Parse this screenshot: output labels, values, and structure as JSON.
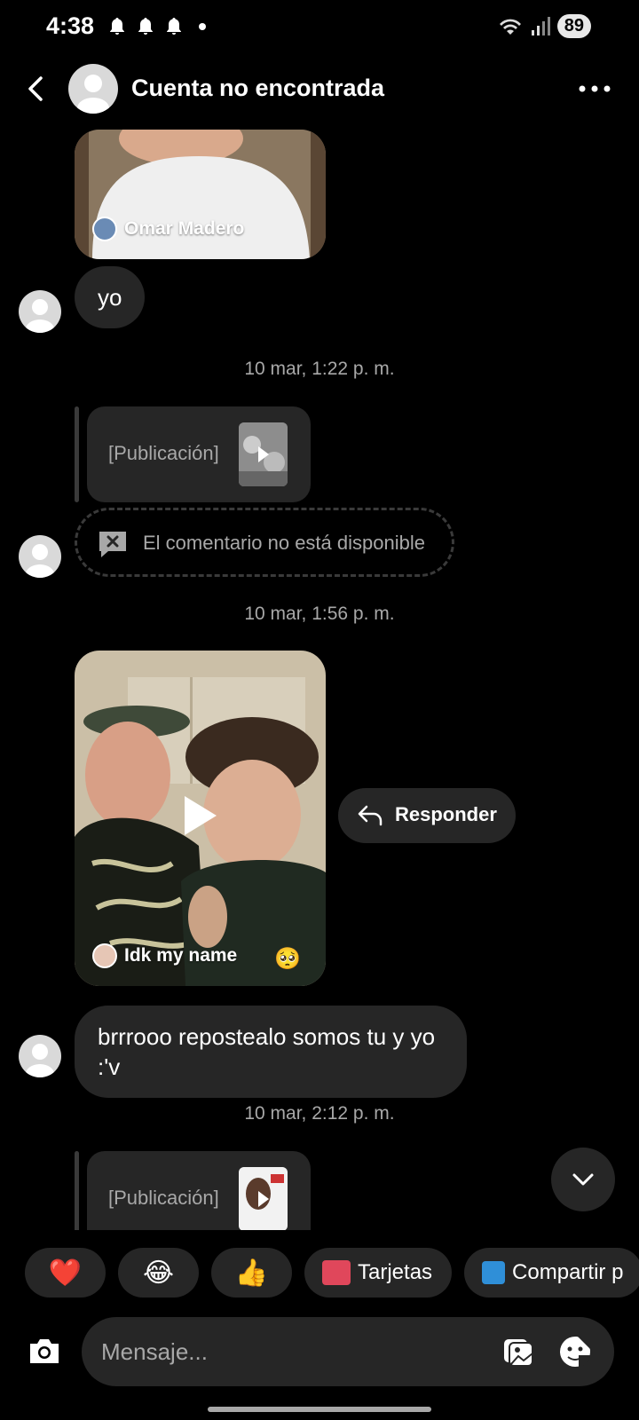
{
  "status_bar": {
    "time": "4:38",
    "battery": "89",
    "notification_icons": [
      "bell-icon",
      "bell-icon",
      "bell-icon"
    ]
  },
  "header": {
    "title": "Cuenta no encontrada",
    "back_icon": "chevron-left-icon",
    "more_icon": "more-horizontal-icon"
  },
  "messages": {
    "reel1": {
      "owner": "Omar Madero"
    },
    "text1": "yo",
    "timestamp1": "10 mar, 1:22 p. m.",
    "post1": {
      "label": "[Publicación]"
    },
    "unavailable_comment": "El comentario no está disponible",
    "timestamp2": "10 mar, 1:56 p. m.",
    "reel2": {
      "owner": "Idk my name",
      "sticker": "🥺"
    },
    "reply_button": "Responder",
    "text2": "brrrooo repostealo somos tu y yo :'v",
    "timestamp3": "10 mar, 2:12 p. m.",
    "post2": {
      "label": "[Publicación]"
    }
  },
  "quick_replies": {
    "emoji1": "❤️",
    "emoji2": "😂",
    "emoji3": "👍",
    "cards": "Tarjetas",
    "share": "Compartir p"
  },
  "composer": {
    "placeholder": "Mensaje..."
  },
  "colors": {
    "background": "#000000",
    "bubble": "#262626",
    "secondary_text": "#a8a8a8"
  }
}
